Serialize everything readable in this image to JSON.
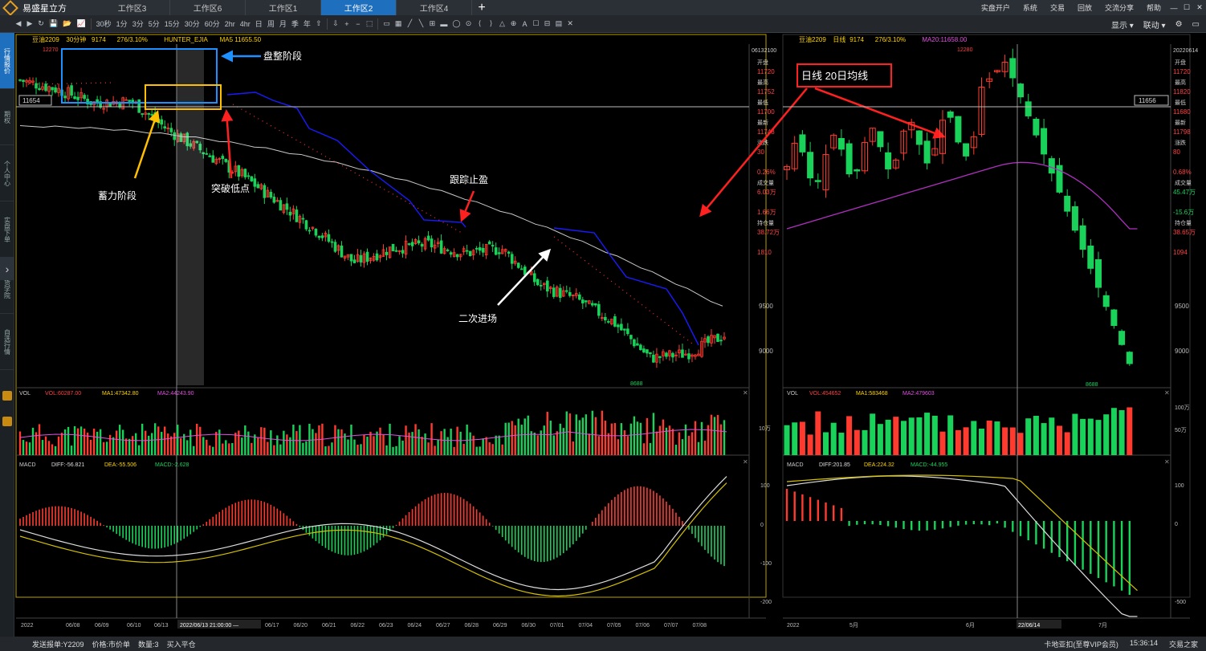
{
  "app": {
    "name": "易盛星立方"
  },
  "tabs": [
    "工作区3",
    "工作区6",
    "工作区1",
    "工作区2",
    "工作区4"
  ],
  "active_tab": 3,
  "system_menu": [
    "实盘开户",
    "系统",
    "交易",
    "回放",
    "交流分享",
    "帮助"
  ],
  "toolbar_right": {
    "display": "显示 ▾",
    "link": "联动 ▾"
  },
  "toolbar_buttons": [
    "◀",
    "▶",
    "↻",
    "💾",
    "📂",
    "📈",
    "30秒",
    "1分",
    "3分",
    "5分",
    "15分",
    "30分",
    "60分",
    "2hr",
    "4hr",
    "日",
    "周",
    "月",
    "季",
    "年",
    "⇧",
    "⇩",
    "+",
    "−",
    "⬚",
    "▭",
    "▦",
    "╱",
    "╲",
    "⊞",
    "▬",
    "◯",
    "⊙",
    "⟨",
    "⟩",
    "△",
    "⊕",
    "A",
    "☐",
    "⊟",
    "▤",
    "✕"
  ],
  "sidebar": [
    "行情报价",
    "期权",
    "个人中心",
    "实盘下单",
    "期货学院",
    "自选行情"
  ],
  "left_panel": {
    "header": {
      "symbol": "豆油2209",
      "period": "30分钟",
      "last": "9174",
      "change": "276/3.10%",
      "indicator": "HUNTER_EJIA",
      "ma": "MA5 11655.50"
    },
    "price_label": "11654",
    "high_label": "12270",
    "low_label": "8688",
    "y_ticks": [
      "9500",
      "9000"
    ],
    "date_labels": [
      "2022",
      "06/08",
      "06/09",
      "06/10",
      "06/13",
      "2022/06/13 21:00:00 —",
      "06/17",
      "06/20",
      "06/21",
      "06/22",
      "06/23",
      "06/24",
      "06/27",
      "06/28",
      "06/29",
      "06/30",
      "07/01",
      "07/04",
      "07/05",
      "07/06",
      "07/07",
      "07/08"
    ],
    "vol_header": {
      "name": "VOL",
      "vol": "VOL:60287.00",
      "ma1": "MA1:47342.80",
      "ma2": "MA2:44243.90"
    },
    "vol_tick": "10万",
    "macd_header": {
      "name": "MACD",
      "diff": "DIFF:-56.821",
      "dea": "DEA:-55.506",
      "macd": "MACD:-2.628"
    },
    "macd_ticks": [
      "100",
      "0",
      "-100",
      "-200"
    ]
  },
  "info_panel": {
    "date": "06132100",
    "rows": [
      [
        "开盘",
        "11720"
      ],
      [
        "最高",
        "11752"
      ],
      [
        "最低",
        "11700"
      ],
      [
        "最新",
        "11748"
      ],
      [
        "涨跌",
        "30"
      ],
      [
        "",
        "0.26%"
      ],
      [
        "成交量",
        "6.03万"
      ],
      [
        "",
        "1.66万"
      ],
      [
        "持仓量",
        "38.72万"
      ],
      [
        "",
        "1810"
      ]
    ]
  },
  "right_panel": {
    "header": {
      "symbol": "豆油2209",
      "period": "日线",
      "last": "9174",
      "change": "276/3.10%",
      "ma": "MA20:11658.00"
    },
    "price_label": "11656",
    "high_label": "12280",
    "low_label": "8688",
    "y_ticks": [
      "9500",
      "9000"
    ],
    "date": "20220614",
    "rows": [
      [
        "开盘",
        "11720"
      ],
      [
        "最高",
        "11820"
      ],
      [
        "最低",
        "11680"
      ],
      [
        "最新",
        "11798"
      ],
      [
        "涨跌",
        "80"
      ],
      [
        "",
        "0.68%"
      ],
      [
        "成交量",
        "45.47万"
      ],
      [
        "",
        "-15.6万"
      ],
      [
        "持仓量",
        "38.65万"
      ],
      [
        "",
        "1094"
      ]
    ],
    "date_labels": [
      "2022",
      "5月",
      "6月",
      "22/06/14",
      "7月"
    ],
    "vol_header": {
      "name": "VOL",
      "vol": "VOL:454652",
      "ma1": "MA1:583468",
      "ma2": "MA2:479603"
    },
    "vol_ticks": [
      "100万",
      "50万"
    ],
    "macd_header": {
      "name": "MACD",
      "diff": "DIFF:201.85",
      "dea": "DEA:224.32",
      "macd": "MACD:-44.955"
    },
    "macd_ticks": [
      "100",
      "0",
      "-500"
    ]
  },
  "annotations": {
    "consolidation": "盘整阶段",
    "accumulation": "蓄力阶段",
    "breakout": "突破低点",
    "trailing": "跟踪止盈",
    "reentry": "二次进场",
    "daily": "日线 20日均线"
  },
  "statusbar": {
    "left": [
      "发送报单:Y2209",
      "价格:市价单",
      "数量:3",
      "买入平仓"
    ],
    "right": [
      "卡地亚扣(至尊VIP会员)",
      "15:36:14",
      "交易之家"
    ]
  },
  "colors": {
    "up": "#ff3b30",
    "down": "#19d25a",
    "trail": "#1a1aff",
    "ma_left": "#c8c8c8",
    "ma_right": "#b030c0",
    "annotation_arrow": "#ff2020"
  },
  "chart_data": [
    {
      "type": "candlestick",
      "title": "豆油2209 30分钟",
      "x": [
        "06/08",
        "06/09",
        "06/10",
        "06/13",
        "06/17",
        "06/20",
        "06/21",
        "06/22",
        "06/23",
        "06/24",
        "06/27",
        "06/28",
        "06/29",
        "06/30",
        "07/01",
        "07/04",
        "07/05",
        "07/06",
        "07/07",
        "07/08"
      ],
      "close": [
        11950,
        11850,
        11700,
        11720,
        11400,
        11150,
        10900,
        10600,
        10300,
        9950,
        10100,
        10150,
        10050,
        10100,
        9700,
        9550,
        9300,
        8900,
        8950,
        9150
      ],
      "high_label": 12270,
      "low_label": 8688,
      "ylim": [
        8600,
        12300
      ]
    },
    {
      "type": "candlestick",
      "title": "豆油2209 日线",
      "series": [
        {
          "name": "MA20",
          "values": []
        }
      ],
      "x": [
        "2022",
        "5月",
        "6月",
        "22/06/14",
        "7月"
      ],
      "high_label": 12280,
      "low_label": 8688,
      "ylim": [
        8600,
        12300
      ]
    }
  ]
}
